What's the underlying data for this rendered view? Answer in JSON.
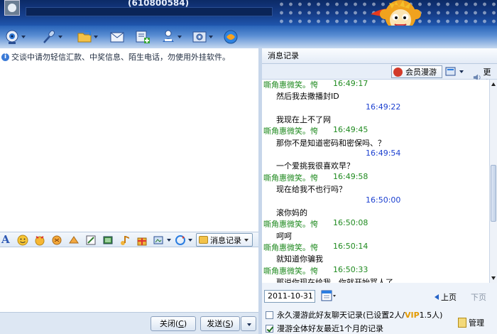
{
  "header": {
    "qq_number": "(610800584)"
  },
  "toolbar": {
    "icons": [
      "webcam-icon",
      "microphone-icon",
      "folder-icon",
      "mail-icon",
      "add-contact-icon",
      "group-icon",
      "settings-icon",
      "app-icon"
    ]
  },
  "notice": "交谈中请勿轻信汇款、中奖信息、陌生电话，勿使用外挂软件。",
  "format_bar": {
    "message_record_label": "消息记录"
  },
  "send_bar": {
    "close_label": "关闭(",
    "close_key": "C",
    "send_label": "发送(",
    "send_key": "S"
  },
  "history_panel": {
    "title": "消息记录",
    "vip_label": "会员漫游",
    "more_label": "更多",
    "messages": [
      {
        "type": "other",
        "name": "嘶角惠微笑。恗",
        "time": "16:49:17"
      },
      {
        "type": "text",
        "text": "然后我去撒播封ID"
      },
      {
        "type": "self",
        "time": "16:49:22"
      },
      {
        "type": "text",
        "text": "我现在上不了网"
      },
      {
        "type": "other",
        "name": "嘶角惠微笑。恗",
        "time": "16:49:45"
      },
      {
        "type": "text",
        "text": "那你不是知道密码和密保吗、？"
      },
      {
        "type": "self",
        "time": "16:49:54"
      },
      {
        "type": "text",
        "text": "一个爱挑我很喜欢早？"
      },
      {
        "type": "other",
        "name": "嘶角惠微笑。恗",
        "time": "16:49:58"
      },
      {
        "type": "text",
        "text": "现在给我不也行吗？"
      },
      {
        "type": "self",
        "time": "16:50:00"
      },
      {
        "type": "text",
        "text": "滚你妈的"
      },
      {
        "type": "other",
        "name": "嘶角惠微笑。恗",
        "time": "16:50:08"
      },
      {
        "type": "text",
        "text": "呵呵"
      },
      {
        "type": "other",
        "name": "嘶角惠微笑。恗",
        "time": "16:50:14"
      },
      {
        "type": "text",
        "text": "就知道你骗我"
      },
      {
        "type": "other",
        "name": "嘶角惠微笑。恗",
        "time": "16:50:33"
      },
      {
        "type": "text",
        "text": "那说你现在给我，你就开始骂人了"
      }
    ],
    "date_value": "2011-10-31",
    "prev_label": "上页",
    "next_label": "下页",
    "option1_text": "永久漫游此好友聊天记录(已设置2人/",
    "option1_vip": "VIP",
    "option1_tail": "1.5人)",
    "option2_text": "漫游全体好友最近1个月的记录",
    "manage_label": "管理"
  },
  "colors": {
    "header_bg": "#163f8c",
    "peer_name": "#1f8a1f",
    "self_time": "#1b3fd0"
  }
}
